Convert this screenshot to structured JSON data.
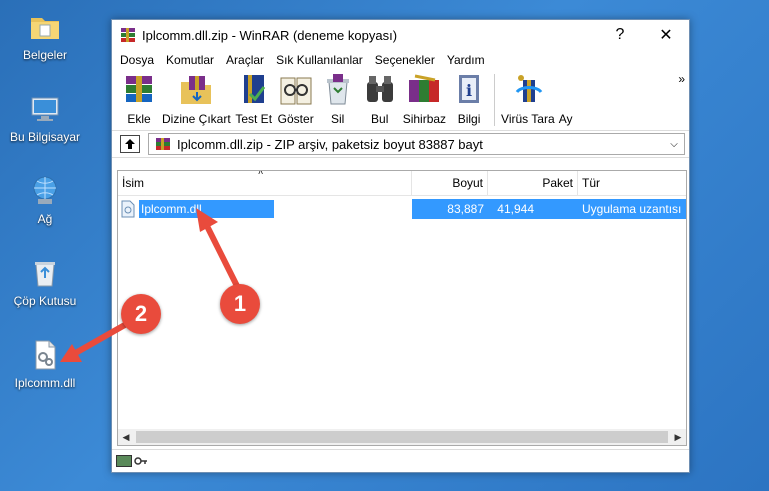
{
  "desktop": {
    "icons": [
      {
        "label": "Belgeler",
        "icon": "folder-documents-icon"
      },
      {
        "label": "Bu Bilgisayar",
        "icon": "computer-icon"
      },
      {
        "label": "Ağ",
        "icon": "network-icon"
      },
      {
        "label": "Çöp Kutusu",
        "icon": "recycle-bin-icon"
      },
      {
        "label": "Iplcomm.dll",
        "icon": "dll-file-icon"
      }
    ]
  },
  "window": {
    "title": "Iplcomm.dll.zip - WinRAR (deneme kopyası)",
    "help_button": "?",
    "close_button": "✕"
  },
  "menu": [
    "Dosya",
    "Komutlar",
    "Araçlar",
    "Sık Kullanılanlar",
    "Seçenekler",
    "Yardım"
  ],
  "toolbar": {
    "buttons": [
      {
        "label": "Ekle",
        "icon": "add-archive-icon"
      },
      {
        "label": "Dizine Çıkart",
        "icon": "extract-to-icon"
      },
      {
        "label": "Test Et",
        "icon": "test-icon"
      },
      {
        "label": "Göster",
        "icon": "view-icon"
      },
      {
        "label": "Sil",
        "icon": "delete-icon"
      },
      {
        "label": "Bul",
        "icon": "find-icon"
      },
      {
        "label": "Sihirbaz",
        "icon": "wizard-icon"
      },
      {
        "label": "Bilgi",
        "icon": "info-icon"
      },
      {
        "label": "Virüs Tara",
        "icon": "virus-scan-icon"
      },
      {
        "label": "Ay",
        "icon": "more-tool-icon"
      }
    ],
    "overflow": "»"
  },
  "path": {
    "text": "Iplcomm.dll.zip - ZIP arşiv, paketsiz boyut 83887 bayt"
  },
  "file_list": {
    "columns": [
      "İsim",
      "Boyut",
      "Paket",
      "Tür"
    ],
    "rows": [
      {
        "name": "Iplcomm.dll",
        "size": "83,887",
        "packed": "41,944",
        "type": "Uygulama uzantısı"
      }
    ]
  },
  "annotations": {
    "marker1": "1",
    "marker2": "2"
  },
  "colors": {
    "selection": "#3399ff",
    "marker": "#e94b3c",
    "desktop": "#2a6fb8"
  }
}
